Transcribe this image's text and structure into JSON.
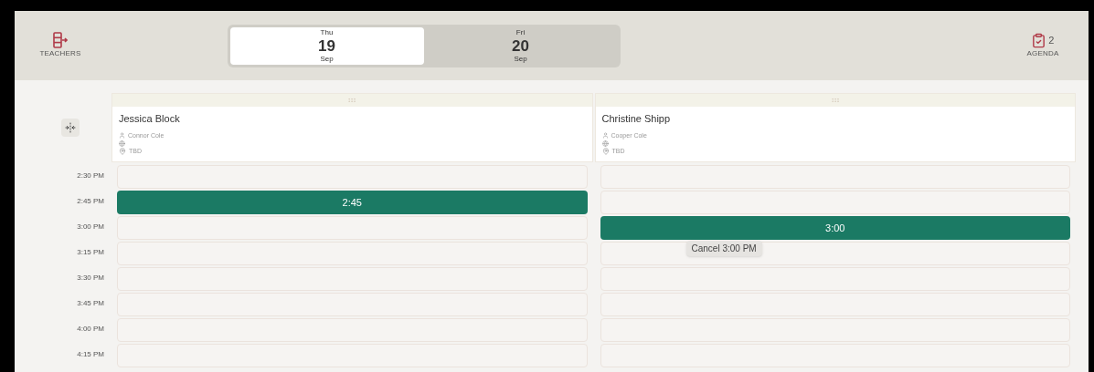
{
  "header": {
    "left_button": {
      "label": "TEACHERS"
    },
    "day_tabs": [
      {
        "weekday": "Thu",
        "day": "19",
        "month": "Sep",
        "selected": true
      },
      {
        "weekday": "Fri",
        "day": "20",
        "month": "Sep",
        "selected": false
      }
    ],
    "agenda": {
      "label": "AGENDA",
      "count": "2"
    }
  },
  "times": [
    "2:30 PM",
    "2:45 PM",
    "3:00 PM",
    "3:15 PM",
    "3:30 PM",
    "3:45 PM",
    "4:00 PM",
    "4:15 PM"
  ],
  "columns": [
    {
      "teacher": "Jessica Block",
      "student": "Connor Cole",
      "location": "TBD",
      "slots": [
        {
          "kind": "empty"
        },
        {
          "kind": "booked",
          "label": "2:45"
        },
        {
          "kind": "empty"
        },
        {
          "kind": "empty"
        },
        {
          "kind": "empty"
        },
        {
          "kind": "empty"
        },
        {
          "kind": "empty"
        },
        {
          "kind": "empty"
        }
      ]
    },
    {
      "teacher": "Christine Shipp",
      "student": "Cooper Cole",
      "location": "TBD",
      "slots": [
        {
          "kind": "empty"
        },
        {
          "kind": "empty"
        },
        {
          "kind": "booked",
          "label": "3:00",
          "tooltip": "Cancel 3:00 PM"
        },
        {
          "kind": "empty"
        },
        {
          "kind": "empty"
        },
        {
          "kind": "empty"
        },
        {
          "kind": "empty"
        },
        {
          "kind": "empty"
        }
      ]
    }
  ]
}
